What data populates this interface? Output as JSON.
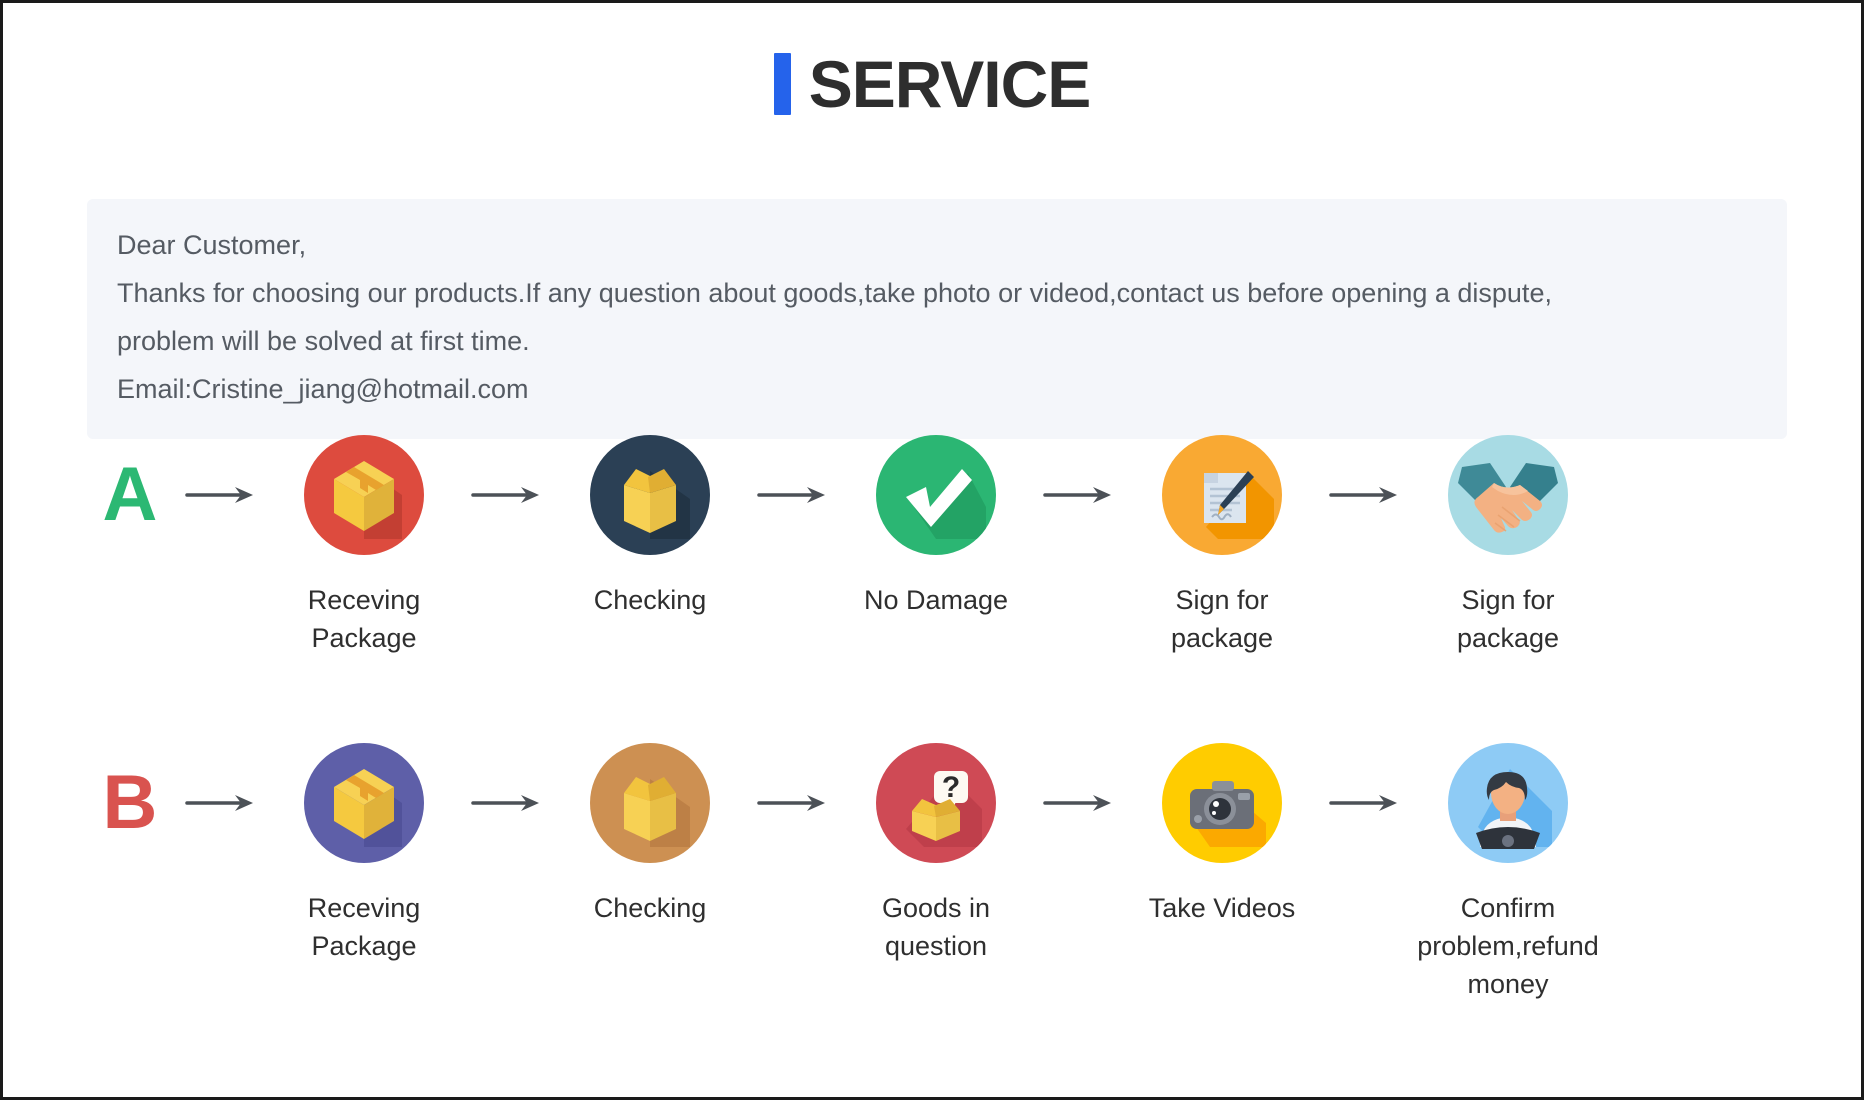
{
  "header": {
    "accent_color": "#2563eb",
    "title": "SERVICE"
  },
  "notice": {
    "background": "#f4f6fa",
    "lines": [
      "Dear Customer,",
      "Thanks for choosing our products.If any question about goods,take photo or videod,contact us before opening a dispute,",
      "problem will be solved at first time.",
      "Email:Cristine_jiang@hotmail.com"
    ]
  },
  "flows": [
    {
      "letter": "A",
      "letter_color": "#2cb873",
      "steps": [
        {
          "icon": "closed-box-icon",
          "label": "Receving Package",
          "circle_color": "#dd4b3e"
        },
        {
          "icon": "open-box-icon",
          "label": "Checking",
          "circle_color": "#2b4055"
        },
        {
          "icon": "checkmark-icon",
          "label": "No Damage",
          "circle_color": "#2bb673"
        },
        {
          "icon": "sign-document-icon",
          "label": "Sign for package",
          "circle_color": "#f9a933"
        },
        {
          "icon": "handshake-icon",
          "label": "Sign for package",
          "circle_color": "#a8dbe4"
        }
      ]
    },
    {
      "letter": "B",
      "letter_color": "#d9534f",
      "steps": [
        {
          "icon": "closed-box-icon",
          "label": "Receving Package",
          "circle_color": "#5e5fa8"
        },
        {
          "icon": "open-box-icon",
          "label": "Checking",
          "circle_color": "#cd9052"
        },
        {
          "icon": "question-box-icon",
          "label": "Goods in question",
          "circle_color": "#cf4a55"
        },
        {
          "icon": "camera-icon",
          "label": "Take Videos",
          "circle_color": "#ffcc00"
        },
        {
          "icon": "support-agent-icon",
          "label": "Confirm problem,refund money",
          "circle_color": "#8ecbf5"
        }
      ]
    }
  ],
  "arrow": {
    "name": "right-arrow-icon",
    "color": "#4c5157"
  }
}
